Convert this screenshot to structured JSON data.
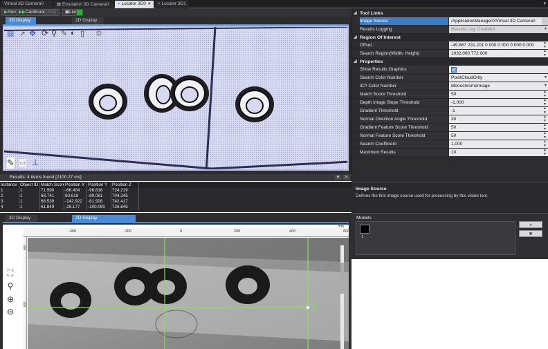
{
  "doc_tabs": [
    {
      "label": "Virtual 3D Camera0",
      "active": false
    },
    {
      "label": "Emulation 3D Camera0",
      "active": false
    },
    {
      "label": "Locator 3D0",
      "active": true
    },
    {
      "label": "Locator 3D1",
      "active": false
    }
  ],
  "toolbar": {
    "run_label": "Run",
    "continuous_label": "Continuous",
    "stop_label": "Stop",
    "live_label": "Live"
  },
  "top_view_tabs": [
    "3D Display",
    "2D Display"
  ],
  "results": {
    "summary": "Results: 4 items found [2100.27 ms]",
    "columns": [
      "Instance",
      "Object ID",
      "Match Score",
      "Position X",
      "Position Y",
      "Position Z"
    ],
    "rows": [
      [
        "1",
        "1",
        "71.990",
        "-66.404",
        "-96.816",
        "724.219"
      ],
      [
        "2",
        "1",
        "68.741",
        "60.619",
        "-89.081",
        "704.345"
      ],
      [
        "3",
        "1",
        "68.539",
        "-142.922",
        "-81.928",
        "742.417"
      ],
      [
        "4",
        "1",
        "61.849",
        "-29.177",
        "-100.090",
        "726.845"
      ]
    ]
  },
  "bottom_view_tabs": [
    "3D Display",
    "2D Display"
  ],
  "ruler": {
    "unit": "mm",
    "top_labels": [
      "-400",
      "-200",
      "0",
      "200",
      "400",
      "600"
    ],
    "left_labels": [
      "-400",
      "-200"
    ]
  },
  "tool_links": {
    "title": "Tool Links",
    "image_source_label": "Image Source",
    "image_source_value": "/ApplicationManager0/Virtual 3D Camera0",
    "results_logging_label": "Results Logging",
    "results_logging_value": "Results Log: Disabled"
  },
  "roi": {
    "title": "Region Of Interest",
    "offset_label": "Offset",
    "offset_value": "-49.867 231.201 0.000 0.000 0.000 0.000",
    "search_region_label": "Search Region(Width, Height)",
    "search_region_value": "1032.000 772.000"
  },
  "properties": {
    "title": "Properties",
    "rows": [
      {
        "name": "Show Results Graphics",
        "value": "",
        "kind": "check"
      },
      {
        "name": "Search Color Number",
        "value": "PointCloudOnly",
        "kind": "dropdown"
      },
      {
        "name": "ICP Color Number",
        "value": "MonochromeImage",
        "kind": "dropdown"
      },
      {
        "name": "Match Score Threshold",
        "value": "50",
        "kind": "spin"
      },
      {
        "name": "Depth Image Slope Threshold",
        "value": "-1.000",
        "kind": "spin"
      },
      {
        "name": "Gradient Threshold",
        "value": "-1",
        "kind": "spin"
      },
      {
        "name": "Normal Direction Angle Threshold",
        "value": "30",
        "kind": "spin"
      },
      {
        "name": "Gradient Feature Score Threshold",
        "value": "50",
        "kind": "spin"
      },
      {
        "name": "Normal Feature Score Threshold",
        "value": "50",
        "kind": "spin"
      },
      {
        "name": "Search Coefficient",
        "value": "1.000",
        "kind": "spin"
      },
      {
        "name": "Maximum Results",
        "value": "10",
        "kind": "spin"
      }
    ]
  },
  "description": {
    "title": "Image Source",
    "text": "Defines the first image source used for processing by this vision tool."
  },
  "models": {
    "title": "Models",
    "items": [
      "1"
    ],
    "add_label": "+",
    "delete_label": "✖"
  },
  "icons": {
    "close": "×",
    "dropdown": "▾",
    "spin": "▲▼",
    "check": "✔"
  },
  "colors": {
    "accent": "#3d7ec9",
    "panel": "#2d2d30",
    "crosshair": "#7fe84a"
  }
}
